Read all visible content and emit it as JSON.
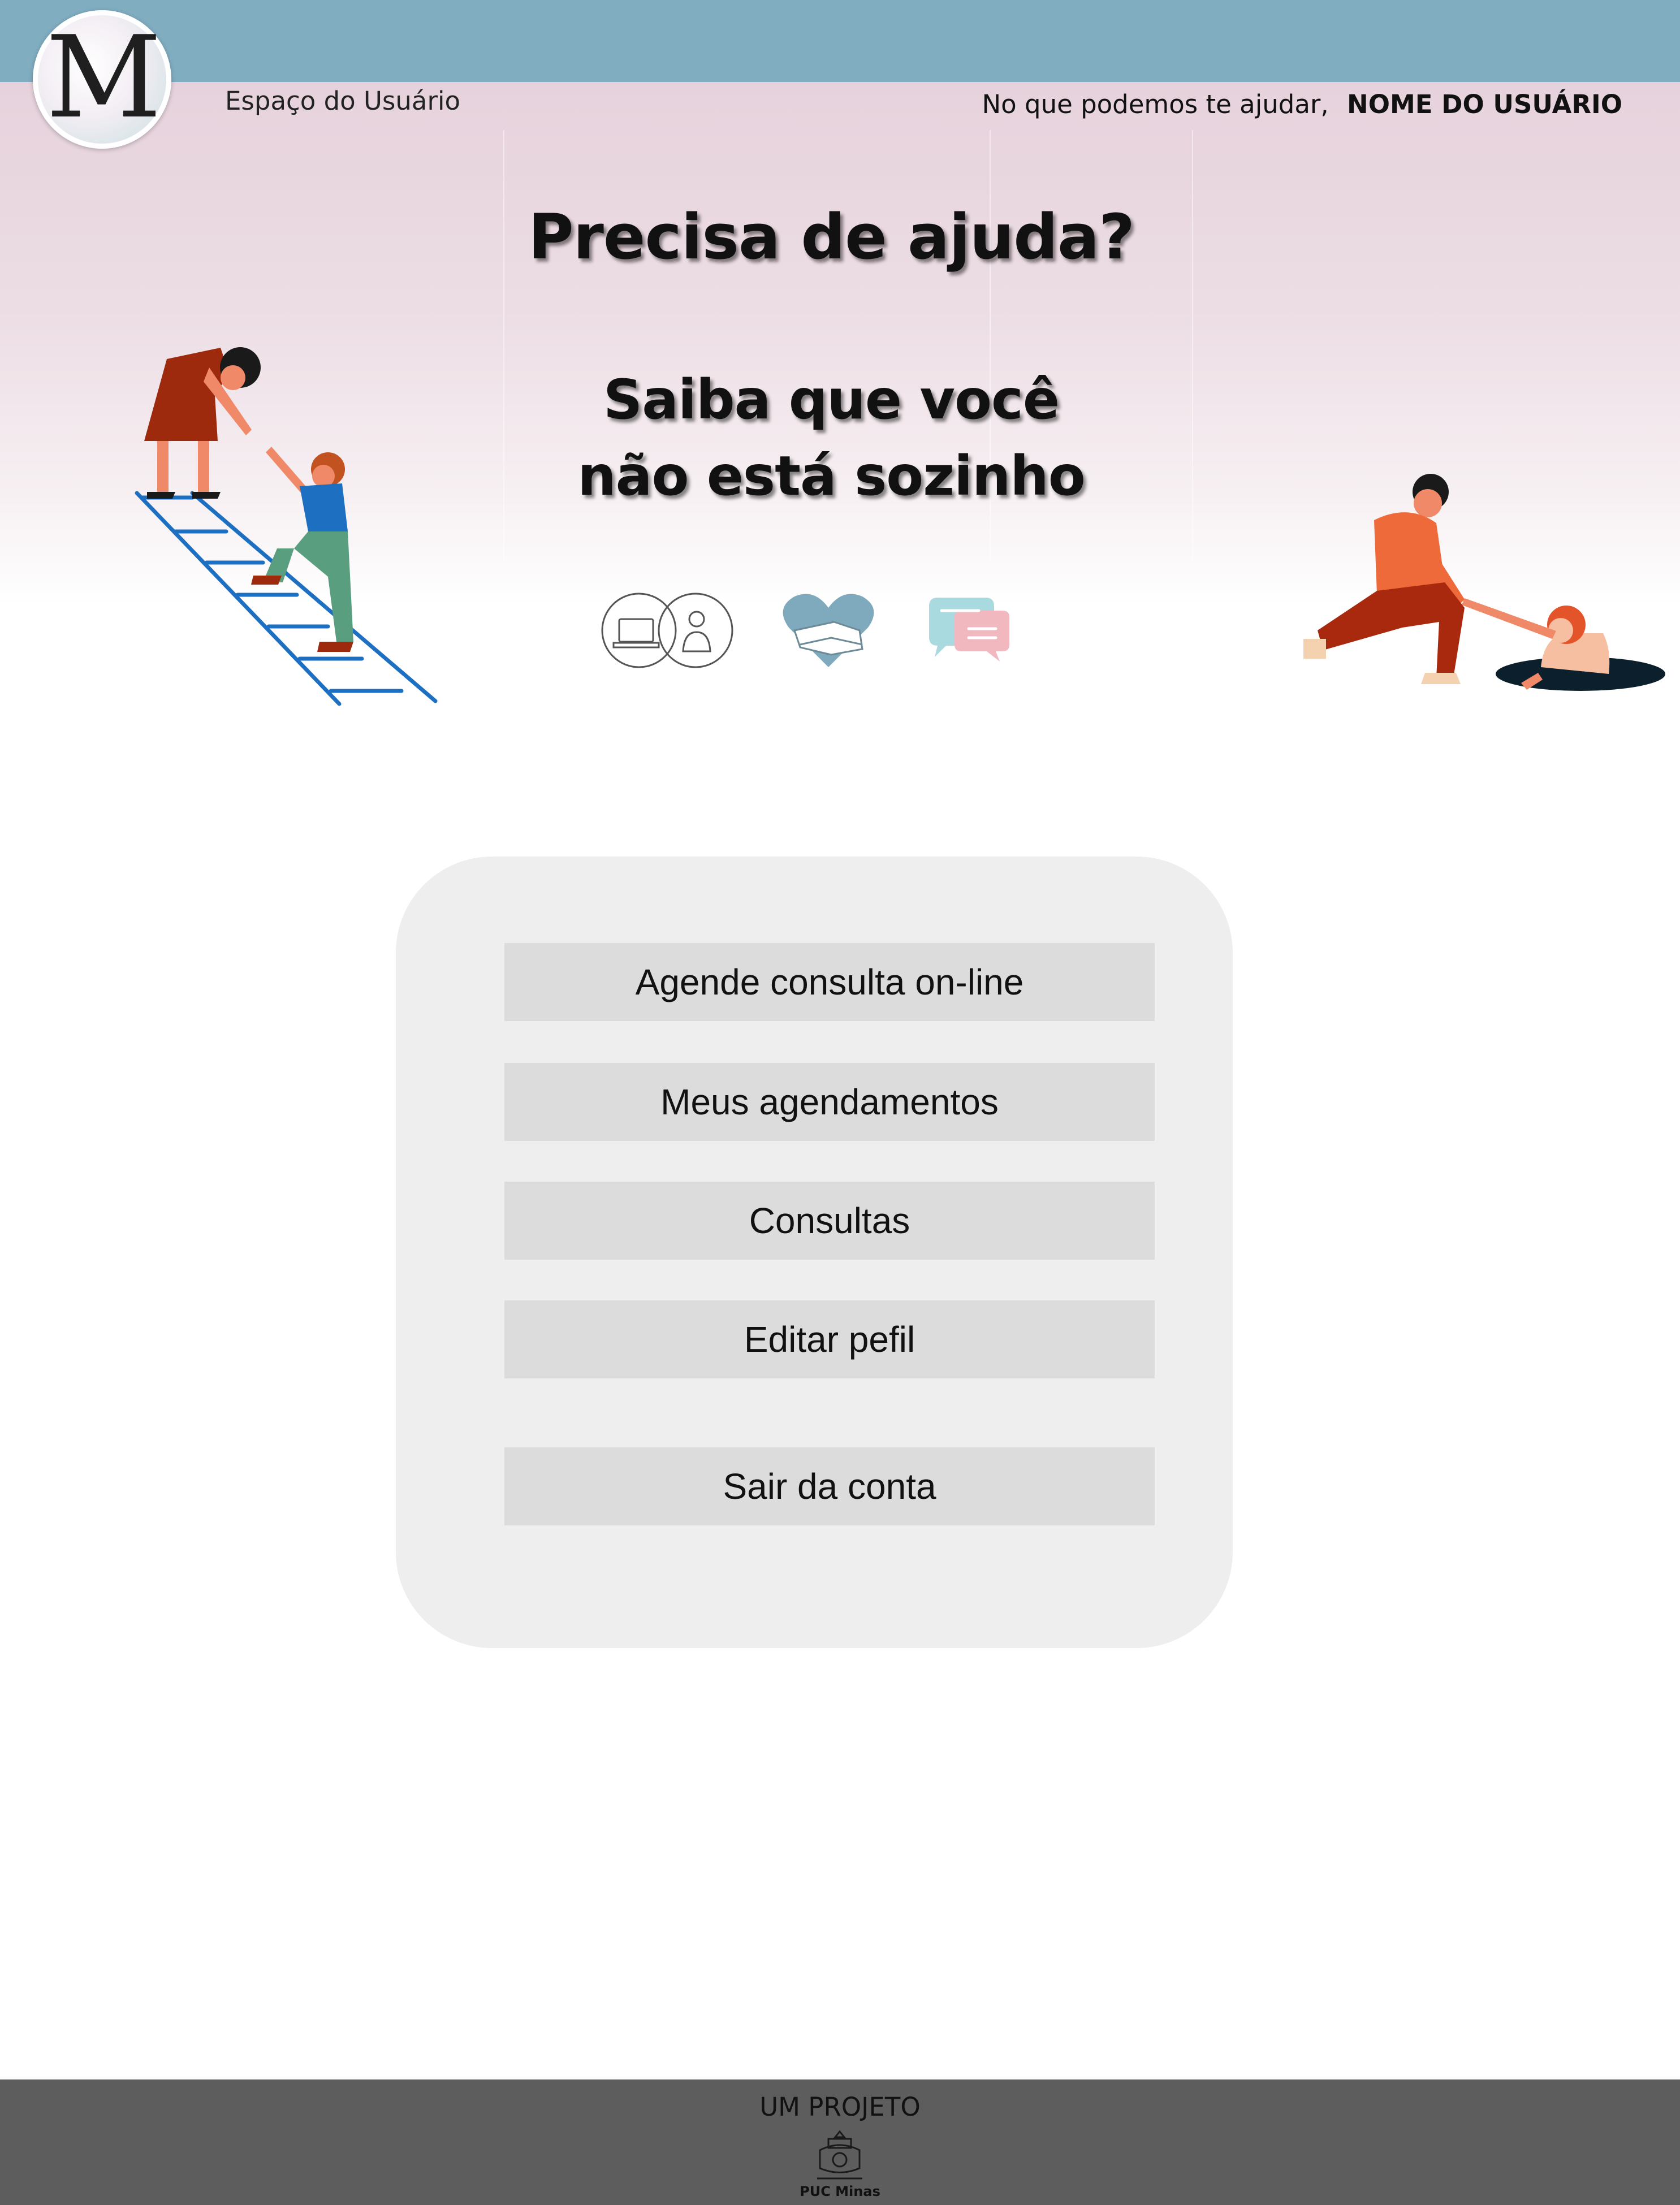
{
  "header": {
    "logo_letter": "M",
    "user_space_label": "Espaço do Usuário",
    "greeting_prefix": "No que podemos te ajudar,",
    "user_name": "NOME DO USUÁRIO",
    "bar_color": "#81adc1"
  },
  "hero": {
    "title": "Precisa de ajuda?",
    "subtitle_line1": "Saiba que você",
    "subtitle_line2": "não está sozinho",
    "icons": [
      "online-consultation-icon",
      "heart-hands-icon",
      "chat-bubbles-icon"
    ]
  },
  "menu": {
    "items": [
      {
        "label": "Agende consulta on-line"
      },
      {
        "label": "Meus agendamentos"
      },
      {
        "label": "Consultas"
      },
      {
        "label": "Editar pefil"
      },
      {
        "label": "Sair da conta"
      }
    ]
  },
  "footer": {
    "project_label": "UM PROJETO",
    "institution": "PUC Minas",
    "background": "#5d5d5d"
  }
}
